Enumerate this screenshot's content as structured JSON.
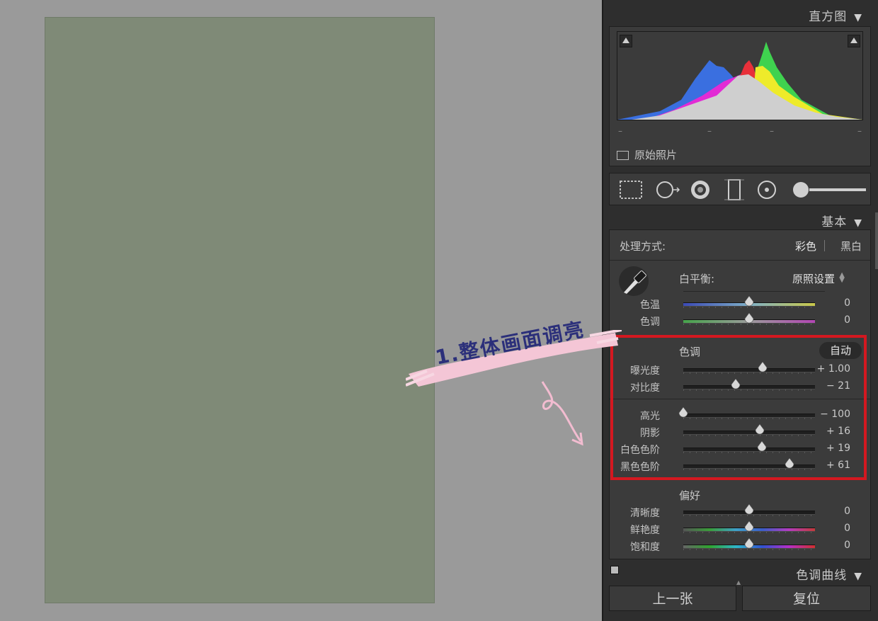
{
  "histogram": {
    "title": "直方图",
    "original_label": "原始照片"
  },
  "basic": {
    "title": "基本",
    "process_label": "处理方式:",
    "process_options": [
      "彩色",
      "黑白"
    ]
  },
  "wb": {
    "label": "白平衡:",
    "value": "原照设置",
    "sliders": [
      {
        "label": "色温",
        "value": "0",
        "fraction": 0.5,
        "gradient": "linear-gradient(90deg,#3b4ab5,#7fb0c8,#c9c84a)"
      },
      {
        "label": "色调",
        "value": "0",
        "fraction": 0.5,
        "gradient": "linear-gradient(90deg,#46a34b,#9c9c9c,#b246b3)"
      }
    ]
  },
  "tone": {
    "title": "色调",
    "auto_label": "自动",
    "sliders": [
      {
        "label": "曝光度",
        "value": "+ 1.00",
        "fraction": 0.6
      },
      {
        "label": "对比度",
        "value": "− 21",
        "fraction": 0.4
      }
    ],
    "sliders2": [
      {
        "label": "高光",
        "value": "− 100",
        "fraction": 0.0
      },
      {
        "label": "阴影",
        "value": "+ 16",
        "fraction": 0.58
      },
      {
        "label": "白色色阶",
        "value": "+ 19",
        "fraction": 0.595
      },
      {
        "label": "黑色色阶",
        "value": "+ 61",
        "fraction": 0.805
      }
    ]
  },
  "presence": {
    "title": "偏好",
    "sliders": [
      {
        "label": "清晰度",
        "value": "0",
        "fraction": 0.5,
        "gradient": "linear-gradient(90deg,#1c1c1c,#1c1c1c)"
      },
      {
        "label": "鲜艳度",
        "value": "0",
        "fraction": 0.5,
        "gradient": "linear-gradient(90deg,#555,#3a9d3a,#3fa0c8,#3c5ec8,#b33cc0,#c23a3a)"
      },
      {
        "label": "饱和度",
        "value": "0",
        "fraction": 0.5,
        "gradient": "linear-gradient(90deg,#666,#2fa32f,#2fb6c8,#3152d0,#b52fc8,#d02f2f)"
      }
    ]
  },
  "tone_curve": {
    "title": "色调曲线"
  },
  "footer": {
    "prev_label": "上一张",
    "reset_label": "复位"
  },
  "annotation": {
    "text": "1.整体画面调亮"
  },
  "colors": {
    "highlight_box": "#d41820",
    "annotation_ribbon": "#f4c6d6",
    "annotation_text": "#2b2f7a"
  }
}
